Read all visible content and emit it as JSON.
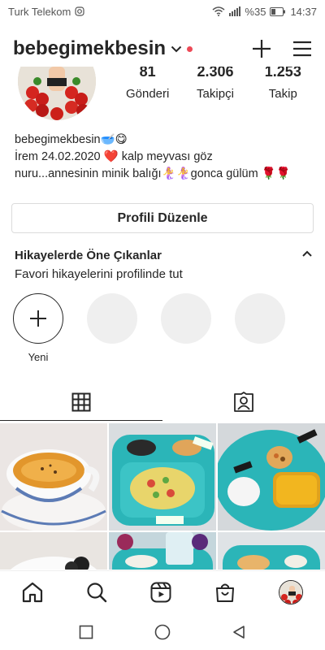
{
  "status_bar": {
    "carrier": "Turk Telekom",
    "battery": "%35",
    "time": "14:37"
  },
  "header": {
    "username": "bebegimekbesin"
  },
  "stats": [
    {
      "value": "81",
      "label": "Gönderi"
    },
    {
      "value": "2.306",
      "label": "Takipçi"
    },
    {
      "value": "1.253",
      "label": "Takip"
    }
  ],
  "bio": {
    "name": "bebegimekbesin🥣😋",
    "line1": "İrem 24.02.2020 ❤️ kalp meyvası göz",
    "line2": "nuru...annesinin minik balığı🧜‍♀️🧜‍♀️gonca gülüm 🌹🌹"
  },
  "edit_profile_label": "Profili Düzenle",
  "highlights": {
    "title": "Hikayelerde Öne Çıkanlar",
    "subtitle": "Favori hikayelerini profilinde tut",
    "new_label": "Yeni"
  },
  "colors": {
    "text": "#262626",
    "notification_dot": "#ed4956",
    "plate_teal": "#2bb5b8",
    "placeholder": "#efefef"
  },
  "icons": {
    "header": [
      "chevron-down-icon",
      "plus-icon",
      "menu-icon"
    ],
    "tabs": [
      "grid-icon",
      "tagged-icon"
    ],
    "bottom_nav": [
      "home-icon",
      "search-icon",
      "reels-icon",
      "shop-icon",
      "profile-avatar"
    ],
    "system_nav": [
      "recents-icon",
      "home-circle-icon",
      "back-icon"
    ]
  }
}
